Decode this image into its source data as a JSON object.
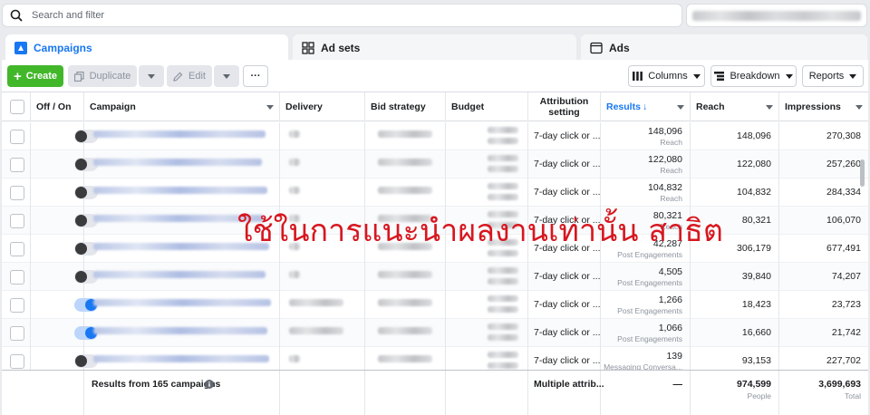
{
  "search": {
    "placeholder": "Search and filter",
    "icon": "search-icon"
  },
  "tabs": [
    {
      "label": "Campaigns",
      "icon": "campaigns-icon",
      "active": true
    },
    {
      "label": "Ad sets",
      "icon": "grid-icon",
      "active": false
    },
    {
      "label": "Ads",
      "icon": "ad-window-icon",
      "active": false
    }
  ],
  "toolbar": {
    "create_label": "Create",
    "duplicate_label": "Duplicate",
    "edit_label": "Edit",
    "more_label": "···",
    "columns_label": "Columns",
    "breakdown_label": "Breakdown",
    "reports_label": "Reports"
  },
  "columns": {
    "off_on": "Off / On",
    "campaign": "Campaign",
    "delivery": "Delivery",
    "bid_strategy": "Bid strategy",
    "budget": "Budget",
    "attribution_line1": "Attribution",
    "attribution_line2": "setting",
    "results": "Results",
    "results_sort": "↓",
    "reach": "Reach",
    "impressions": "Impressions"
  },
  "rows": [
    {
      "on": false,
      "attribution": "7-day click or ...",
      "results": "148,096",
      "result_type": "Reach",
      "reach": "148,096",
      "impressions": "270,308"
    },
    {
      "on": false,
      "attribution": "7-day click or ...",
      "results": "122,080",
      "result_type": "Reach",
      "reach": "122,080",
      "impressions": "257,260"
    },
    {
      "on": false,
      "attribution": "7-day click or ...",
      "results": "104,832",
      "result_type": "Reach",
      "reach": "104,832",
      "impressions": "284,334"
    },
    {
      "on": false,
      "attribution": "7-day click or ...",
      "results": "80,321",
      "result_type": "Reach",
      "reach": "80,321",
      "impressions": "106,070"
    },
    {
      "on": false,
      "attribution": "7-day click or ...",
      "results": "42,287",
      "result_type": "Post Engagements",
      "reach": "306,179",
      "impressions": "677,491"
    },
    {
      "on": false,
      "attribution": "7-day click or ...",
      "results": "4,505",
      "result_type": "Post Engagements",
      "reach": "39,840",
      "impressions": "74,207"
    },
    {
      "on": true,
      "attribution": "7-day click or ...",
      "results": "1,266",
      "result_type": "Post Engagements",
      "reach": "18,423",
      "impressions": "23,723"
    },
    {
      "on": true,
      "attribution": "7-day click or ...",
      "results": "1,066",
      "result_type": "Post Engagements",
      "reach": "16,660",
      "impressions": "21,742"
    },
    {
      "on": false,
      "attribution": "7-day click or ...",
      "results": "139",
      "result_type": "Messaging Conversa...",
      "reach": "93,153",
      "impressions": "227,702"
    }
  ],
  "footer": {
    "summary": "Results from 165 campaigns",
    "info_icon": "info-icon",
    "attribution": "Multiple attrib...",
    "results": "—",
    "reach": "974,599",
    "reach_sub": "People",
    "impressions": "3,699,693",
    "impressions_sub": "Total"
  },
  "watermark": "ใช้ในการแนะนำผลงานเท่านั้น สาธิต",
  "colors": {
    "accent": "#1877f2",
    "create_green": "#42b72a",
    "watermark_red": "#d7171f"
  }
}
